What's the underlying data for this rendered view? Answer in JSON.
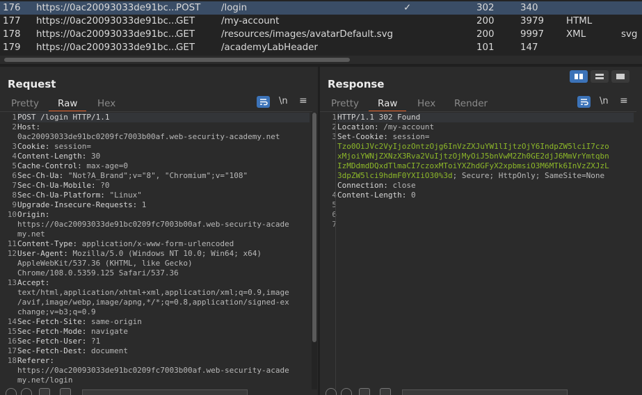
{
  "history": {
    "rows": [
      {
        "num": "176",
        "host": "https://0ac20093033de91bc...",
        "method": "POST",
        "url": "/login",
        "check": "✓",
        "status": "302",
        "length": "340",
        "mime": "",
        "ext": ""
      },
      {
        "num": "177",
        "host": "https://0ac20093033de91bc...",
        "method": "GET",
        "url": "/my-account",
        "check": "",
        "status": "200",
        "length": "3979",
        "mime": "HTML",
        "ext": ""
      },
      {
        "num": "178",
        "host": "https://0ac20093033de91bc...",
        "method": "GET",
        "url": "/resources/images/avatarDefault.svg",
        "check": "",
        "status": "200",
        "length": "9997",
        "mime": "XML",
        "ext": "svg"
      },
      {
        "num": "179",
        "host": "https://0ac20093033de91bc...",
        "method": "GET",
        "url": "/academyLabHeader",
        "check": "",
        "status": "101",
        "length": "147",
        "mime": "",
        "ext": ""
      }
    ]
  },
  "request": {
    "title": "Request",
    "tabs": [
      "Pretty",
      "Raw",
      "Hex"
    ],
    "active_tab": "Raw",
    "toolbar": {
      "newline": "\\n",
      "menu": "≡"
    },
    "line_numbers": [
      "1",
      "2",
      "",
      "3",
      "4",
      "5",
      "6",
      "7",
      "8",
      "9",
      "10",
      "",
      "",
      "11",
      "12",
      "",
      "",
      "13",
      "",
      "",
      "",
      "14",
      "15",
      "16",
      "17",
      "18",
      "",
      ""
    ],
    "lines": [
      {
        "k": "POST /login HTTP/1.1",
        "v": ""
      },
      {
        "k": "Host:",
        "v": ""
      },
      {
        "k": "",
        "v": "0ac20093033de91bc0209fc7003b00af.web-security-academy.net"
      },
      {
        "k": "Cookie:",
        "v": " session="
      },
      {
        "k": "Content-Length:",
        "v": " 30"
      },
      {
        "k": "Cache-Control:",
        "v": " max-age=0"
      },
      {
        "k": "Sec-Ch-Ua:",
        "v": " \"Not?A_Brand\";v=\"8\", \"Chromium\";v=\"108\""
      },
      {
        "k": "Sec-Ch-Ua-Mobile:",
        "v": " ?0"
      },
      {
        "k": "Sec-Ch-Ua-Platform:",
        "v": " \"Linux\""
      },
      {
        "k": "Upgrade-Insecure-Requests:",
        "v": " 1"
      },
      {
        "k": "Origin:",
        "v": ""
      },
      {
        "k": "",
        "v": "https://0ac20093033de91bc0209fc7003b00af.web-security-acade"
      },
      {
        "k": "",
        "v": "my.net"
      },
      {
        "k": "Content-Type:",
        "v": " application/x-www-form-urlencoded"
      },
      {
        "k": "User-Agent:",
        "v": " Mozilla/5.0 (Windows NT 10.0; Win64; x64)"
      },
      {
        "k": "",
        "v": "AppleWebKit/537.36 (KHTML, like Gecko)"
      },
      {
        "k": "",
        "v": "Chrome/108.0.5359.125 Safari/537.36"
      },
      {
        "k": "Accept:",
        "v": ""
      },
      {
        "k": "",
        "v": "text/html,application/xhtml+xml,application/xml;q=0.9,image"
      },
      {
        "k": "",
        "v": "/avif,image/webp,image/apng,*/*;q=0.8,application/signed-ex"
      },
      {
        "k": "",
        "v": "change;v=b3;q=0.9"
      },
      {
        "k": "Sec-Fetch-Site:",
        "v": " same-origin"
      },
      {
        "k": "Sec-Fetch-Mode:",
        "v": " navigate"
      },
      {
        "k": "Sec-Fetch-User:",
        "v": " ?1"
      },
      {
        "k": "Sec-Fetch-Dest:",
        "v": " document"
      },
      {
        "k": "Referer:",
        "v": ""
      },
      {
        "k": "",
        "v": "https://0ac20093033de91bc0209fc7003b00af.web-security-acade"
      },
      {
        "k": "",
        "v": "my.net/login"
      }
    ]
  },
  "response": {
    "title": "Response",
    "tabs": [
      "Pretty",
      "Raw",
      "Hex",
      "Render"
    ],
    "active_tab": "Raw",
    "toolbar": {
      "newline": "\\n",
      "menu": "≡"
    },
    "line_numbers": [
      "1",
      "2",
      "3",
      "",
      "",
      "",
      "",
      "",
      "4",
      "5",
      "6",
      "7"
    ],
    "lines": [
      {
        "k": "HTTP/1.1 302 Found",
        "v": "",
        "c": ""
      },
      {
        "k": "Location:",
        "v": " /my-account",
        "c": ""
      },
      {
        "k": "Set-Cookie:",
        "v": " session=",
        "c": ""
      },
      {
        "k": "",
        "v": "",
        "c": "Tzo0OiJVc2VyIjozOntzOjg6InVzZXJuYW1lIjtzOjY6IndpZW5lciI7czo"
      },
      {
        "k": "",
        "v": "",
        "c": "xMjoiYWNjZXNzX3Rva2VuIjtzOjMyOiJ5bnVwM2Zh0GE2djJ6MmVrYmtqbn"
      },
      {
        "k": "",
        "v": "",
        "c": "IzMDdmdDQxdTlmaCI7czoxMToiYXZhdGFyX2xpbmsiO3M6MTk6InVzZXJzL"
      },
      {
        "k": "",
        "v": "; Secure; HttpOnly; SameSite=None",
        "c": "3dpZW5lci9hdmF0YXIiO30%3d"
      },
      {
        "k": "Connection:",
        "v": " close",
        "c": ""
      },
      {
        "k": "Content-Length:",
        "v": " 0",
        "c": ""
      },
      {
        "k": "",
        "v": "",
        "c": ""
      },
      {
        "k": "",
        "v": "",
        "c": ""
      }
    ]
  },
  "colors": {
    "accent": "#e8652f",
    "selection": "#3a4d66",
    "cookie": "#8db829",
    "toggle": "#3c73b8"
  }
}
